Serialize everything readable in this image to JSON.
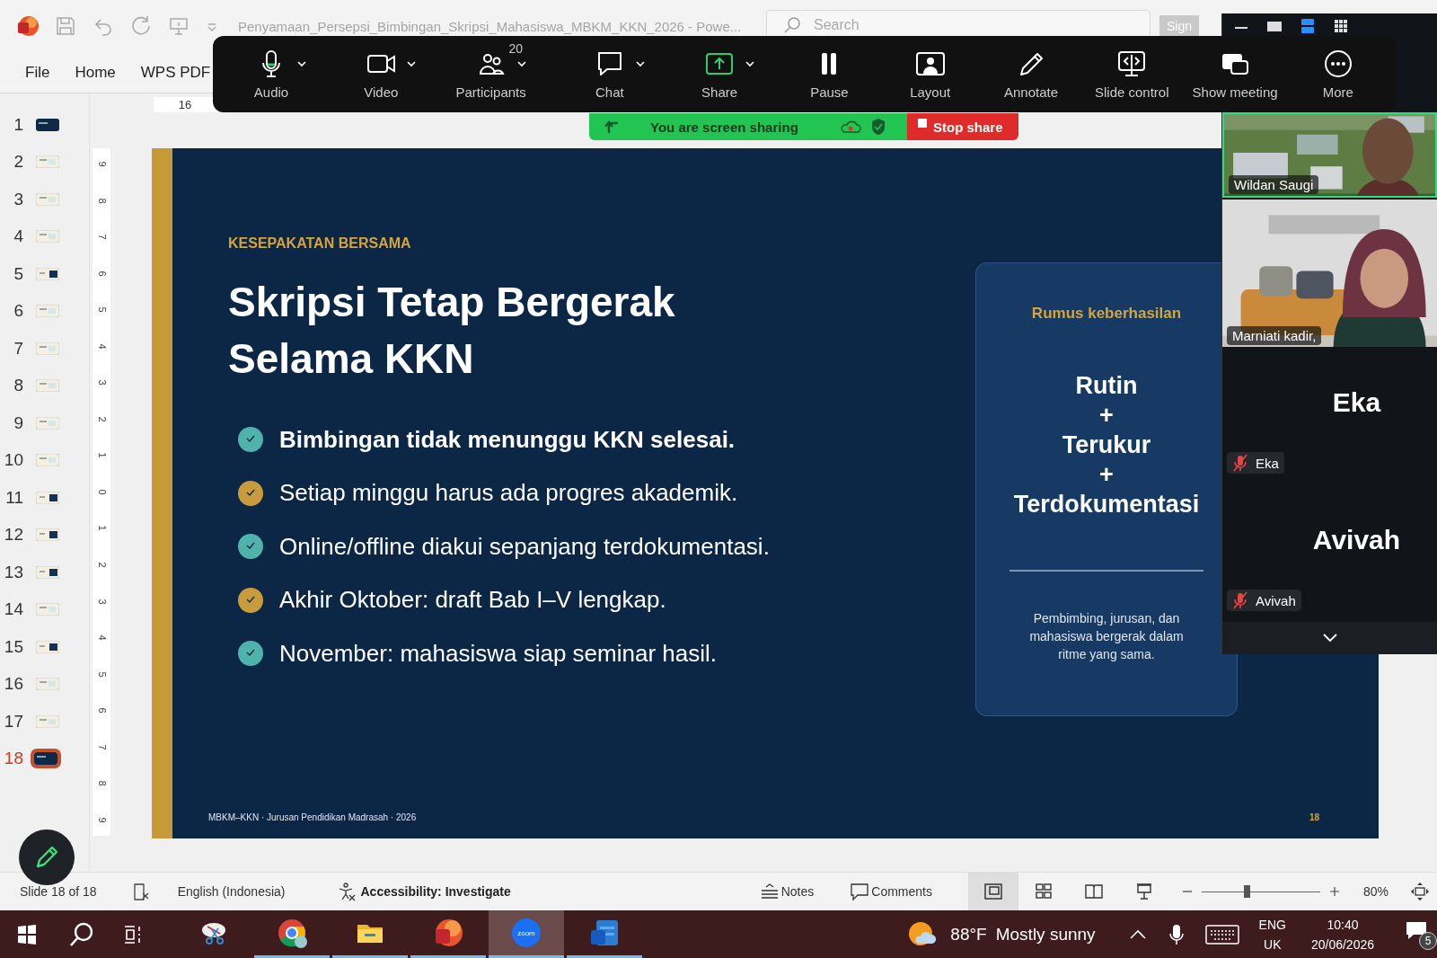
{
  "titlebar": {
    "title": "Penyamaan_Persepsi_Bimbingan_Skripsi_Mahasiswa_MBKM_KKN_2026  -  Powe...",
    "search": {
      "placeholder": "Search"
    },
    "sign_in": "Sign"
  },
  "ribbon_tabs": [
    "File",
    "Home",
    "WPS PDF"
  ],
  "ruler": {
    "horizontal": "16",
    "vertical": [
      "9",
      "8",
      "7",
      "6",
      "5",
      "4",
      "3",
      "2",
      "1",
      "0",
      "1",
      "2",
      "3",
      "4",
      "5",
      "6",
      "7",
      "8",
      "9"
    ]
  },
  "thumbnails": [
    {
      "number": "1",
      "kind": "dark",
      "selected": false
    },
    {
      "number": "2",
      "kind": "light",
      "selected": false
    },
    {
      "number": "3",
      "kind": "light",
      "selected": false
    },
    {
      "number": "4",
      "kind": "light",
      "selected": false
    },
    {
      "number": "5",
      "kind": "split",
      "selected": false
    },
    {
      "number": "6",
      "kind": "light",
      "selected": false
    },
    {
      "number": "7",
      "kind": "light",
      "selected": false
    },
    {
      "number": "8",
      "kind": "light",
      "selected": false
    },
    {
      "number": "9",
      "kind": "light",
      "selected": false
    },
    {
      "number": "10",
      "kind": "light",
      "selected": false
    },
    {
      "number": "11",
      "kind": "split",
      "selected": false
    },
    {
      "number": "12",
      "kind": "split",
      "selected": false
    },
    {
      "number": "13",
      "kind": "split",
      "selected": false
    },
    {
      "number": "14",
      "kind": "light",
      "selected": false
    },
    {
      "number": "15",
      "kind": "split",
      "selected": false
    },
    {
      "number": "16",
      "kind": "light",
      "selected": false
    },
    {
      "number": "17",
      "kind": "light",
      "selected": false
    },
    {
      "number": "18",
      "kind": "dark",
      "selected": true
    }
  ],
  "slide": {
    "kicker": "KESEPAKATAN BERSAMA",
    "title_lines": [
      "Skripsi Tetap Bergerak",
      "Selama KKN"
    ],
    "points": [
      {
        "text": "Bimbingan tidak menunggu KKN selesai.",
        "bold": true,
        "color": "#4fb3ac"
      },
      {
        "text": "Setiap minggu harus ada progres akademik.",
        "bold": false,
        "color": "#c89b3c"
      },
      {
        "text": "Online/offline diakui sepanjang terdokumentasi.",
        "bold": false,
        "color": "#4fb3ac"
      },
      {
        "text": "Akhir Oktober: draft Bab I–V lengkap.",
        "bold": false,
        "color": "#c89b3c"
      },
      {
        "text": "November: mahasiswa siap seminar hasil.",
        "bold": false,
        "color": "#4fb3ac"
      }
    ],
    "card": {
      "heading": "Rumus keberhasilan",
      "formula": [
        "Rutin",
        "+",
        "Terukur",
        "+",
        "Terdokumentasi"
      ],
      "note": "Pembimbing, jurusan, dan mahasiswa bergerak dalam ritme yang sama."
    },
    "footer": "MBKM–KKN · Jurusan Pendidikan Madrasah · 2026",
    "number": "18"
  },
  "zoom_toolbar": [
    {
      "label": "Audio",
      "kind": "mic",
      "menu": true,
      "active": false
    },
    {
      "label": "Video",
      "kind": "camera",
      "menu": true,
      "active": false
    },
    {
      "label": "Participants",
      "kind": "people",
      "menu": true,
      "count": "20",
      "active": false
    },
    {
      "label": "Chat",
      "kind": "chat",
      "menu": true,
      "active": false
    },
    {
      "label": "Share",
      "kind": "share",
      "menu": true,
      "active": true
    },
    {
      "label": "Pause",
      "kind": "pause",
      "menu": false,
      "active": false
    },
    {
      "label": "Layout",
      "kind": "layout",
      "menu": false,
      "active": false
    },
    {
      "label": "Annotate",
      "kind": "pencil",
      "menu": false,
      "active": false
    },
    {
      "label": "Slide control",
      "kind": "slides",
      "menu": false,
      "active": false
    },
    {
      "label": "Show meeting",
      "kind": "meeting",
      "menu": false,
      "active": false
    },
    {
      "label": "More",
      "kind": "more",
      "menu": false,
      "active": false
    }
  ],
  "sharing_banner": {
    "message": "You are screen sharing",
    "stop": "Stop share"
  },
  "video_panel": {
    "views": [
      {
        "kind": "minimize",
        "selected": false
      },
      {
        "kind": "single",
        "selected": false
      },
      {
        "kind": "strip",
        "selected": true
      },
      {
        "kind": "grid",
        "selected": false
      }
    ],
    "tiles": [
      {
        "kind": "video",
        "name": "Wildan Saugi",
        "speaking": true,
        "muted": false
      },
      {
        "kind": "video",
        "name": "Marniati kadir,",
        "speaking": false,
        "muted": false
      },
      {
        "kind": "avatar",
        "display_name": "Eka",
        "name": "Eka",
        "speaking": false,
        "muted": true
      },
      {
        "kind": "avatar",
        "display_name": "Avivah",
        "name": "Avivah",
        "speaking": false,
        "muted": true
      }
    ]
  },
  "status_bar": {
    "slide": "Slide 18 of 18",
    "language": "English (Indonesia)",
    "accessibility": "Accessibility: Investigate",
    "notes": "Notes",
    "comments": "Comments",
    "views": [
      {
        "kind": "normal",
        "selected": true
      },
      {
        "kind": "sorter",
        "selected": false
      },
      {
        "kind": "reading",
        "selected": false
      },
      {
        "kind": "show",
        "selected": false
      }
    ],
    "zoom": {
      "level": 0.38,
      "reading": "80%"
    }
  },
  "taskbar": {
    "apps": [
      {
        "kind": "snip",
        "running": false,
        "selected": false
      },
      {
        "kind": "chrome",
        "running": true,
        "selected": false
      },
      {
        "kind": "files",
        "running": true,
        "selected": false
      },
      {
        "kind": "powerpoint",
        "running": true,
        "selected": false
      },
      {
        "kind": "zoom",
        "label": "zoom",
        "running": true,
        "selected": true
      },
      {
        "kind": "word",
        "running": true,
        "selected": false
      }
    ],
    "temperature": "88°F",
    "weather": "Mostly sunny",
    "language": [
      "ENG",
      "UK"
    ],
    "time": "10:40",
    "date": "20/06/2026",
    "notifications": "5"
  }
}
